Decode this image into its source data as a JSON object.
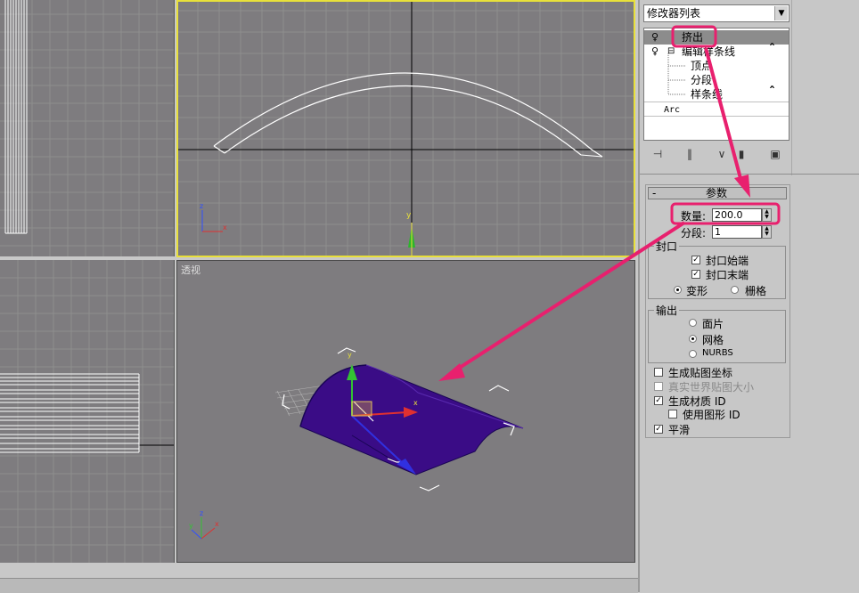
{
  "modifier_list": {
    "label": "修改器列表"
  },
  "stack": {
    "items": [
      {
        "label": "挤出"
      },
      {
        "label": "编辑样条线"
      },
      {
        "label": "顶点"
      },
      {
        "label": "分段"
      },
      {
        "label": "样条线"
      },
      {
        "label": "Arc"
      }
    ]
  },
  "params": {
    "header_minus": "-",
    "title": "参数",
    "amount_label": "数量:",
    "amount_value": "200.0",
    "segments_label": "分段:",
    "segments_value": "1",
    "capping": {
      "group_label": "封口",
      "cap_start": "封口始端",
      "cap_end": "封口末端",
      "morph": "变形",
      "grid": "栅格"
    },
    "output": {
      "group_label": "输出",
      "patch": "面片",
      "mesh": "网格",
      "nurbs": "NURBS"
    },
    "gen_mapping": "生成贴图坐标",
    "real_world": "真实世界贴图大小",
    "gen_mat_id": "生成材质 ID",
    "use_shape_id": "使用图形 ID",
    "smooth": "平滑"
  },
  "viewport": {
    "perspective_label": "透视"
  },
  "axes": {
    "x": "x",
    "y": "y",
    "z": "z"
  },
  "colors": {
    "viewport_bg": "#7e7c7f",
    "active_border": "#e8e03a",
    "annotation": "#e8206e",
    "object": "#3a0c86"
  }
}
